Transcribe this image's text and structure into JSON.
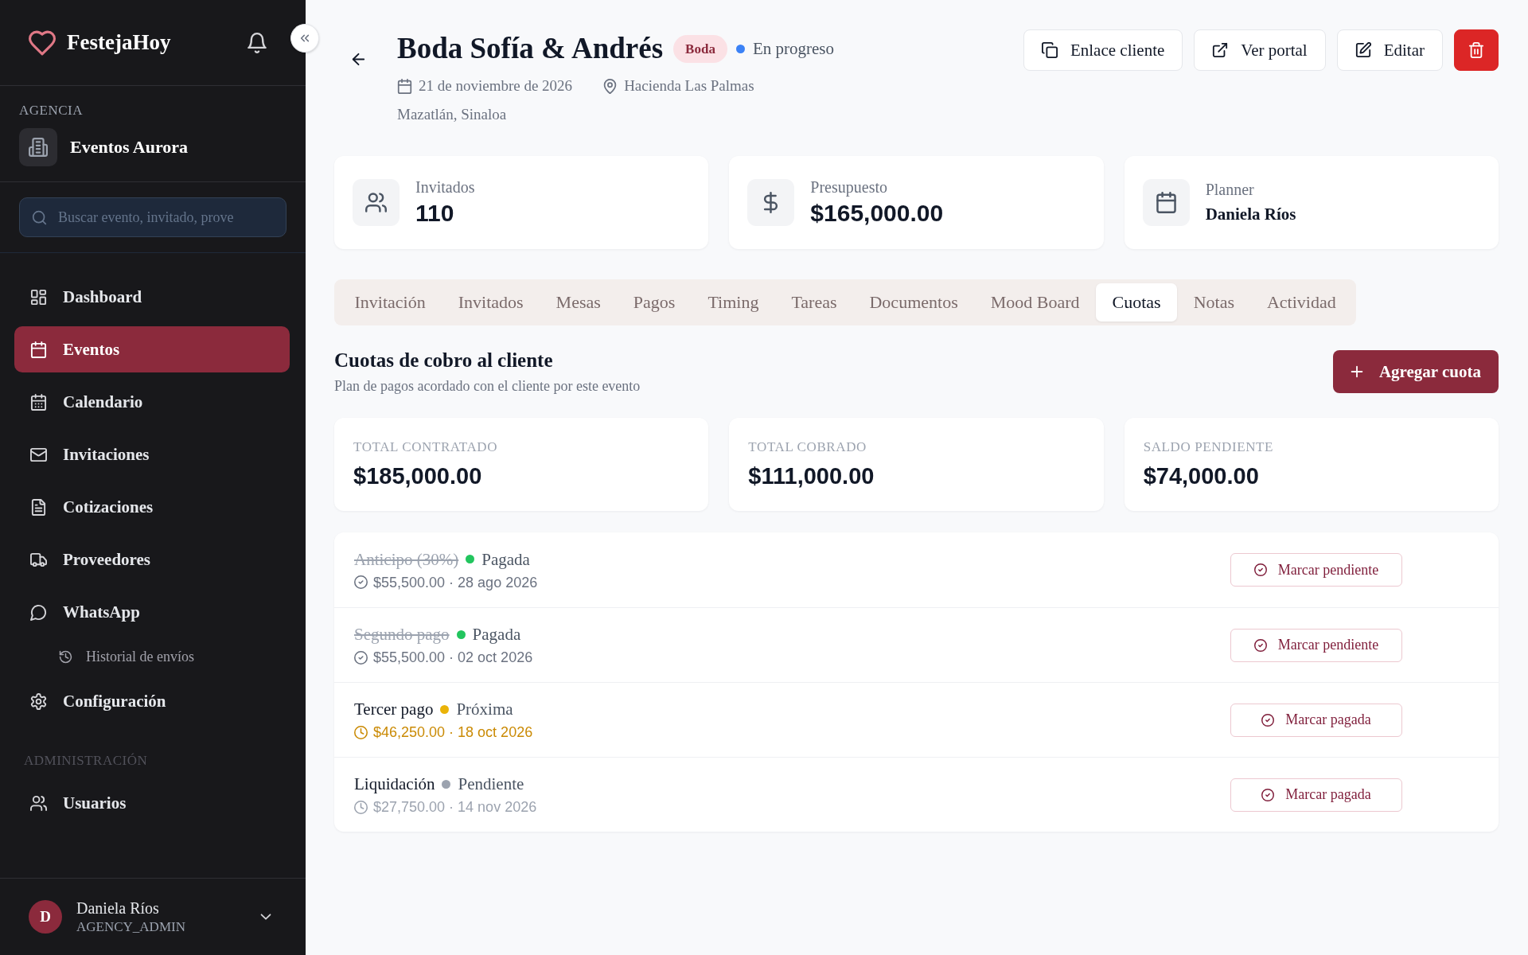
{
  "sidebar": {
    "brand": "FestejaHoy",
    "agency_label": "AGENCIA",
    "agency_name": "Eventos Aurora",
    "search": {
      "placeholder": "Buscar evento, invitado, prove"
    },
    "nav": [
      {
        "label": "Dashboard",
        "selected": false
      },
      {
        "label": "Eventos",
        "selected": true
      },
      {
        "label": "Calendario",
        "selected": false
      },
      {
        "label": "Invitaciones",
        "selected": false
      },
      {
        "label": "Cotizaciones",
        "selected": false
      },
      {
        "label": "Proveedores",
        "selected": false
      },
      {
        "label": "WhatsApp",
        "selected": false,
        "children": [
          {
            "label": "Historial de envíos",
            "selected": false
          }
        ]
      },
      {
        "label": "Configuración",
        "selected": false
      }
    ],
    "admin": {
      "label": "ADMINISTRACIÓN",
      "items": [
        {
          "label": "Usuarios",
          "selected": false
        }
      ]
    },
    "user": {
      "initial": "D",
      "name": "Daniela Ríos",
      "role": "AGENCY_ADMIN"
    }
  },
  "event": {
    "title": "Boda Sofía & Andrés",
    "tag": "Boda",
    "status": {
      "label": "En progreso",
      "color": "#3b82f6"
    },
    "date": "21 de noviembre de 2026",
    "venue": "Hacienda Las Palmas",
    "city": "Mazatlán, Sinaloa",
    "actions": [
      {
        "label": "Enlace cliente",
        "kind": "outline"
      },
      {
        "label": "Ver portal",
        "kind": "outline"
      },
      {
        "label": "Editar",
        "kind": "outline"
      },
      {
        "kind": "danger"
      }
    ]
  },
  "stats": [
    {
      "label": "Invitados",
      "value": "110",
      "kind": "figure"
    },
    {
      "label": "Presupuesto",
      "value": "$165,000.00",
      "kind": "figure"
    },
    {
      "label": "Planner",
      "value": "Daniela Ríos",
      "kind": "name"
    }
  ],
  "tabs": [
    {
      "label": "Invitación",
      "selected": false
    },
    {
      "label": "Invitados",
      "selected": false
    },
    {
      "label": "Mesas",
      "selected": false
    },
    {
      "label": "Pagos",
      "selected": false
    },
    {
      "label": "Timing",
      "selected": false
    },
    {
      "label": "Tareas",
      "selected": false
    },
    {
      "label": "Documentos",
      "selected": false
    },
    {
      "label": "Mood Board",
      "selected": false
    },
    {
      "label": "Cuotas",
      "selected": true
    },
    {
      "label": "Notas",
      "selected": false
    },
    {
      "label": "Actividad",
      "selected": false
    }
  ],
  "installments_section": {
    "title": "Cuotas de cobro al cliente",
    "subtitle": "Plan de pagos acordado con el cliente por este evento",
    "add_button": "Agregar cuota",
    "totals": [
      {
        "label": "TOTAL CONTRATADO",
        "value": "$185,000.00"
      },
      {
        "label": "TOTAL COBRADO",
        "value": "$111,000.00"
      },
      {
        "label": "SALDO PENDIENTE",
        "value": "$74,000.00"
      }
    ],
    "installments": [
      {
        "name": "Anticipo (30%)",
        "kind": "paid",
        "status": "Pagada",
        "color": "#22c55e",
        "detail": "$55,500.00 · 28 ago 2026",
        "action": "Marcar pendiente"
      },
      {
        "name": "Segundo pago",
        "kind": "paid",
        "status": "Pagada",
        "color": "#22c55e",
        "detail": "$55,500.00 · 02 oct 2026",
        "action": "Marcar pendiente"
      },
      {
        "name": "Tercer pago",
        "kind": "upcoming",
        "status": "Próxima",
        "color": "#eab308",
        "detail": "$46,250.00 · 18 oct 2026",
        "action": "Marcar pagada"
      },
      {
        "name": "Liquidación",
        "kind": "pending",
        "status": "Pendiente",
        "color": "#9ca3af",
        "detail": "$27,750.00 · 14 nov 2026",
        "action": "Marcar pagada"
      }
    ]
  }
}
